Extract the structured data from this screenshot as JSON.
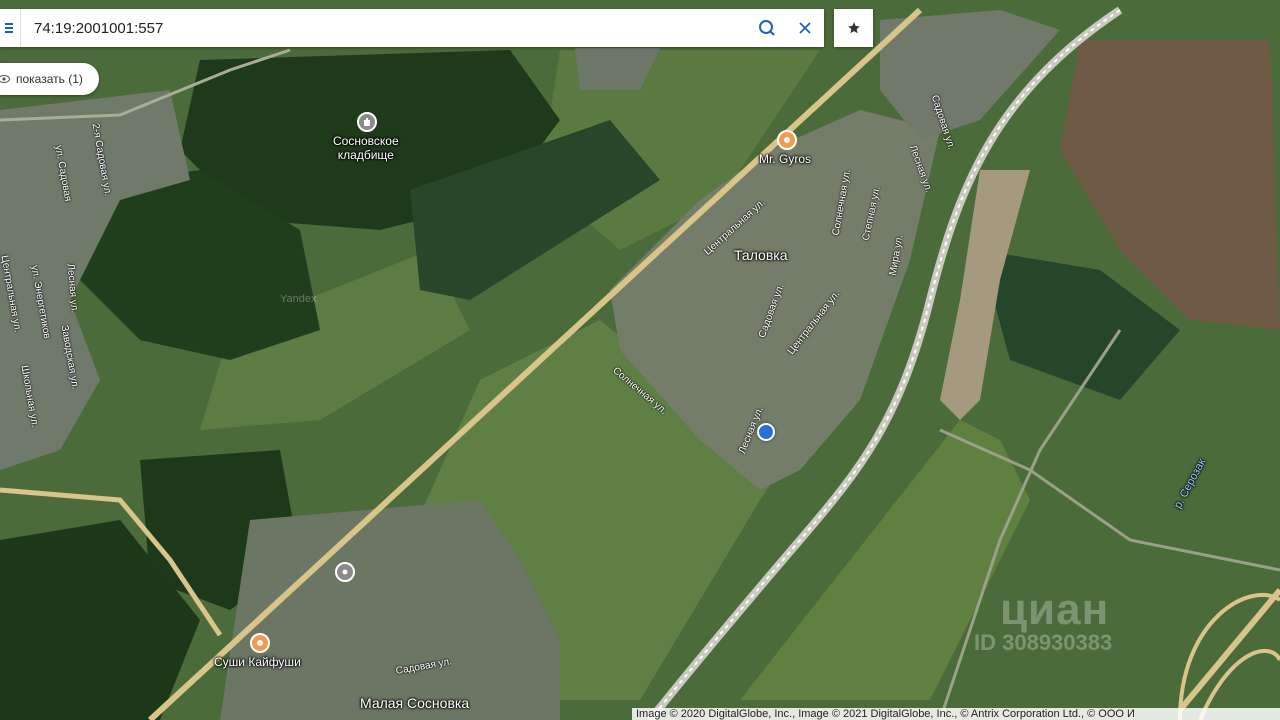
{
  "search": {
    "value": "74:19:2001001:557",
    "placeholder": ""
  },
  "filter": {
    "show_label": "показать (1)"
  },
  "places": {
    "cemetery": "Сосновское\nкладбище",
    "gyros": "Mr. Gyros",
    "talovka": "Таловка",
    "sushi": "Суши Кайфуши",
    "malaya_sosnovka": "Малая Сосновка",
    "river": "р. Серозак"
  },
  "streets": {
    "s1": "2-я Садовая ул.",
    "s2": "ул. Садовая",
    "s3": "Лесная ул.",
    "s4": "ул. Энергетиков",
    "s5": "Центральная ул.",
    "s6": "Заводская ул.",
    "s7": "Школьная ул.",
    "t1": "Центральная ул.",
    "t2": "Садовая ул.",
    "t3": "Центральная ул.",
    "t4": "Солнечная ул.",
    "t5": "Лесная ул.",
    "t6": "Садовая ул.",
    "t7": "Солнечная ул.",
    "t8": "Степная ул.",
    "t9": "Мира ул.",
    "t10": "Лесная ул.",
    "t11": "Садовая ул."
  },
  "watermark": {
    "brand": "циан",
    "id": "ID 308930383",
    "yandex": "Yandex"
  },
  "attribution": "Image © 2020 DigitalGlobe, Inc., Image © 2021 DigitalGlobe, Inc., © Antrix Corporation Ltd., © ООО И",
  "colors": {
    "accent_blue": "#1a5fc7",
    "poi_orange": "#f39a4e",
    "road": "#d9c48a",
    "location": "#2a6fd6"
  },
  "icons": {
    "menu": "menu-icon",
    "search": "search-icon",
    "close": "close-icon",
    "star": "star-icon",
    "eye": "eye-icon"
  }
}
